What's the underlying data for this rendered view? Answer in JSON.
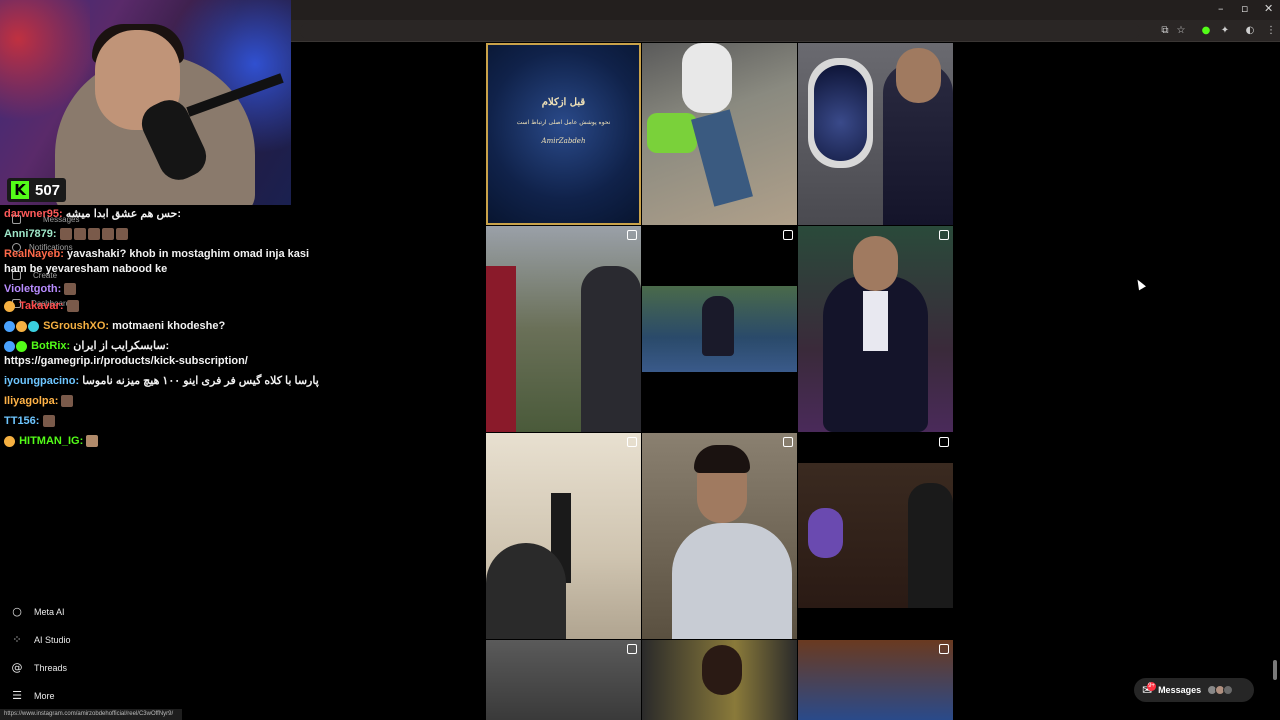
{
  "browser": {
    "window_controls": [
      "–",
      "▫",
      "✕"
    ],
    "toolbar_icons": [
      "cast-icon",
      "star-icon",
      "extension-icon",
      "puzzle-icon",
      "profile-icon",
      "menu-icon"
    ]
  },
  "webcam": {
    "viewer_count": "507",
    "platform_logo": "K"
  },
  "chat": {
    "messages": [
      {
        "user": "darwner95:",
        "user_color": "#ff5a5a",
        "text": "حس هم عشق ابدا میشه:"
      },
      {
        "user": "Anni7879:",
        "user_color": "#9ee6c8",
        "text": ""
      },
      {
        "user": "RealNayeb:",
        "user_color": "#ff6a4a",
        "text": "yavashaki? khob in mostaghim omad inja kasi ham be yevaresham nabood ke"
      },
      {
        "user": "Violetgoth:",
        "user_color": "#b88cff",
        "text": ""
      },
      {
        "user": "Takavar:",
        "user_color": "#ff4a4a",
        "text": ""
      },
      {
        "user": "SGroushXO:",
        "user_color": "#f5b041",
        "text": "motmaeni khodeshe?"
      },
      {
        "user": "BotRix:",
        "user_color": "#53fc18",
        "text": "سابسکرایب از ایران: https://gamegrip.ir/products/kick-subscription/"
      },
      {
        "user": "iyoungpacino:",
        "user_color": "#6ec6ff",
        "text": "پارسا با کلاه گیس فر فری اینو ۱۰۰ هیچ میزنه ناموسا"
      },
      {
        "user": "Iliyagolpa:",
        "user_color": "#ffb347",
        "text": ""
      },
      {
        "user": "TT156:",
        "user_color": "#6ec6ff",
        "text": ""
      },
      {
        "user": "HITMAN_IG:",
        "user_color": "#53fc18",
        "text": ""
      }
    ]
  },
  "ig_sidebar_ghost": {
    "messages": "Messages",
    "notifications": "Notifications",
    "create": "Create",
    "dashboard": "Dashboard"
  },
  "ig_nav": {
    "meta_ai": "Meta AI",
    "ai_studio": "AI Studio",
    "threads": "Threads",
    "more": "More"
  },
  "grid": {
    "first_tile_title": "قبل ازکلام",
    "first_tile_subtitle": "نحوه پوشش عامل اصلی ارتباط است",
    "first_tile_signature": "AmirZabdeh"
  },
  "status_url": "https://www.instagram.com/amirzobdehofficial/reel/C3wOffNyr9/",
  "messages_pill": {
    "label": "Messages",
    "badge": "9+"
  },
  "colors": {
    "kick_green": "#53fc18",
    "notification_red": "#ff3040"
  }
}
